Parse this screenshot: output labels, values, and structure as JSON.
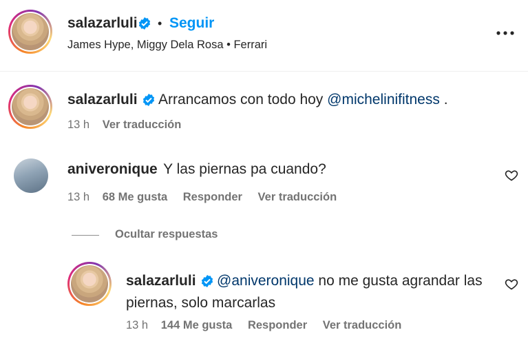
{
  "header": {
    "username": "salazarluli",
    "dot": "•",
    "follow_label": "Seguir",
    "audio": "James Hype, Miggy Dela Rosa • Ferrari",
    "more_icon": "more-horizontal-icon"
  },
  "caption": {
    "username": "salazarluli",
    "text": "Arrancamos con todo hoy ",
    "mention": "@michelinifitness",
    "trailing": " .",
    "time": "13 h",
    "translate": "Ver traducción"
  },
  "comment1": {
    "username": "aniveronique",
    "text": "Y las piernas pa cuando?",
    "time": "13 h",
    "likes": "68 Me gusta",
    "reply": "Responder",
    "translate": "Ver traducción"
  },
  "hide_replies": "Ocultar respuestas",
  "reply1": {
    "username": "salazarluli",
    "mention": "@aniveronique",
    "text_line1": " no me gusta agrandar las",
    "text_line2": "piernas, solo marcarlas",
    "time": "13 h",
    "likes": "144 Me gusta",
    "reply": "Responder",
    "translate": "Ver traducción"
  },
  "colors": {
    "link_blue": "#0095f6",
    "mention_blue": "#00376b",
    "muted": "#737373",
    "text": "#262626"
  }
}
